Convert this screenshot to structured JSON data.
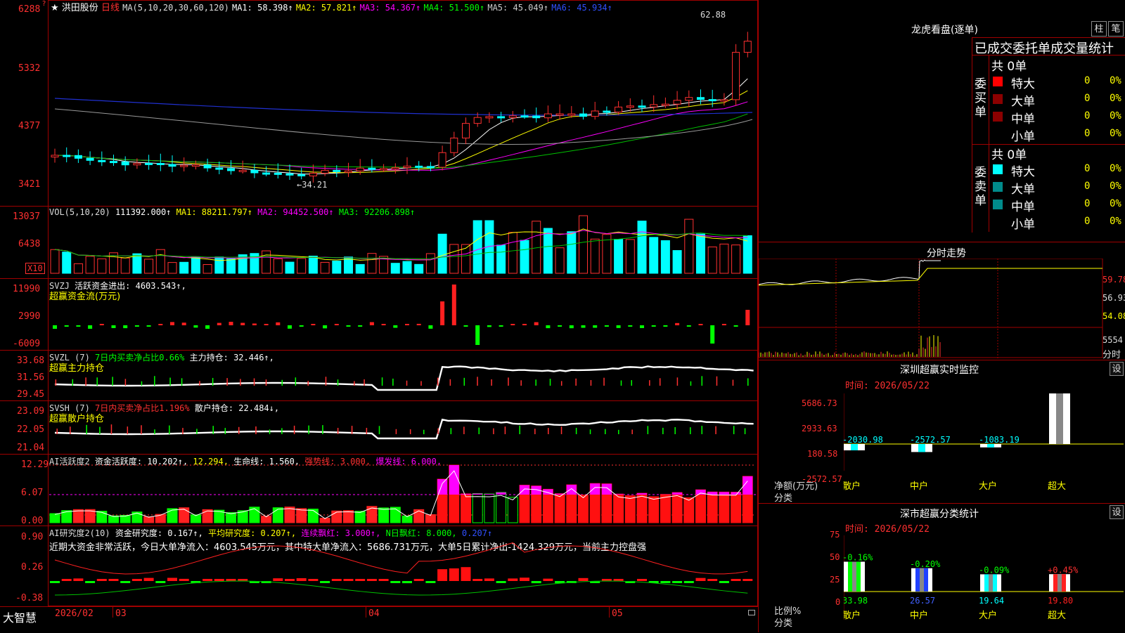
{
  "main": {
    "star": "★",
    "stock_name": "洪田股份",
    "period": "日线",
    "ma_label": "MA(5,10,20,30,60,120)",
    "ma": [
      "MA1: 58.398↑",
      "MA2: 57.821↑",
      "MA3: 54.367↑",
      "MA4: 51.500↑",
      "MA5: 45.049↑",
      "MA6: 45.934↑"
    ],
    "price_ticks": [
      "6288",
      "5332",
      "4377",
      "3421"
    ],
    "high_label": "62.88",
    "low_label": "←34.21"
  },
  "vol": {
    "label": "VOL(5,10,20)",
    "value": "111392.000↑",
    "ma": [
      "MA1: 88211.797↑",
      "MA2: 94452.500↑",
      "MA3: 92206.898↑"
    ],
    "ticks": [
      "13037",
      "6438"
    ],
    "unit": "X10"
  },
  "svzj": {
    "label": "SVZJ",
    "text": "活跃资金进出: 4603.543↑,",
    "name": "超赢资金流(万元)",
    "ticks": [
      "11990",
      "2990",
      "-6009"
    ]
  },
  "svzl": {
    "label": "SVZL (7)",
    "ratio": "7日内买卖净占比0.66%",
    "text": "主力持仓: 32.446↑,",
    "name": "超赢主力持仓",
    "ticks": [
      "33.68",
      "31.56",
      "29.45"
    ]
  },
  "svsh": {
    "label": "SVSH (7)",
    "ratio": "7日内买卖净占比1.196%",
    "text": "散户持仓: 22.484↓,",
    "name": "超赢散户持仓",
    "ticks": [
      "23.09",
      "22.05",
      "21.04"
    ]
  },
  "ai1": {
    "label": "AI活跃度2",
    "t1": "资金活跃度: 10.202↑,",
    "t2": "12.294,",
    "t3": "生命线: 1.560,",
    "t4": "强势线: 3.000,",
    "t5": "爆发线: 6.000,",
    "ticks": [
      "12.29",
      "6.07",
      "0.00"
    ]
  },
  "ai2": {
    "label": "AI研究度2(10)",
    "t1": "资金研究度: 0.167↑,",
    "t2": "平均研究度: 0.207↑,",
    "t3": "连续飘红: 3.000↑,",
    "t4": "N日飘红: 8.000,",
    "t5": "0.207↑",
    "sentence": "近期大资金非常活跃，今日大单净流入：4603.545万元，其中特大单净流入：5686.731万元，大单5日累计净出-1424.329万元，当前主力控盘强",
    "ticks": [
      "0.90",
      "0.26",
      "-0.38"
    ]
  },
  "bottom": {
    "brand": "大智慧",
    "dates": [
      "2026/02",
      "03",
      "04",
      "05"
    ]
  },
  "lhb": {
    "title": "龙虎看盘(逐单)",
    "btn_bar": "柱",
    "btn_pen": "笔",
    "heading": "已成交委托单成交量统计",
    "buy_side": "委买单",
    "sell_side": "委卖单",
    "buy_total": "共 0单",
    "sell_total": "共 0单",
    "rows": [
      "特大",
      "大单",
      "中单",
      "小单"
    ],
    "val": "0",
    "pct": "0%",
    "colors": {
      "buy": [
        "#ff0000",
        "#8b0000",
        "#8b0000",
        "#000000"
      ],
      "sell": [
        "#00ffff",
        "#008b8b",
        "#008b8b",
        "#000000"
      ]
    }
  },
  "fenshi": {
    "title": "分时走势",
    "ticks": [
      "59.78",
      "56.93",
      "54.08"
    ],
    "vol_tick": "5554",
    "vol_label": "分时"
  },
  "monitor": {
    "title": "深圳超赢实时监控",
    "btn": "设",
    "time": "时间: 2026/05/22",
    "ticks": [
      "5686.73",
      "2933.63",
      "180.58",
      "-2572.57"
    ],
    "ylabel1": "净额(万元)",
    "ylabel2": "分类",
    "cats": [
      "散户",
      "中户",
      "大户",
      "超大"
    ],
    "values": [
      "-2030.98",
      "-2572.57",
      "-1083.19",
      "5686.73"
    ]
  },
  "classify": {
    "title": "深市超赢分类统计",
    "btn": "设",
    "time": "时间: 2026/05/22",
    "ticks": [
      "75",
      "50",
      "25",
      "0"
    ],
    "ylabel1": "比例%",
    "ylabel2": "分类",
    "cats": [
      "散户",
      "中户",
      "大户",
      "超大"
    ],
    "changes": [
      "-0.16%",
      "-0.20%",
      "-0.09%",
      "+0.45%"
    ],
    "values": [
      "33.98",
      "26.57",
      "19.64",
      "19.80"
    ]
  }
}
